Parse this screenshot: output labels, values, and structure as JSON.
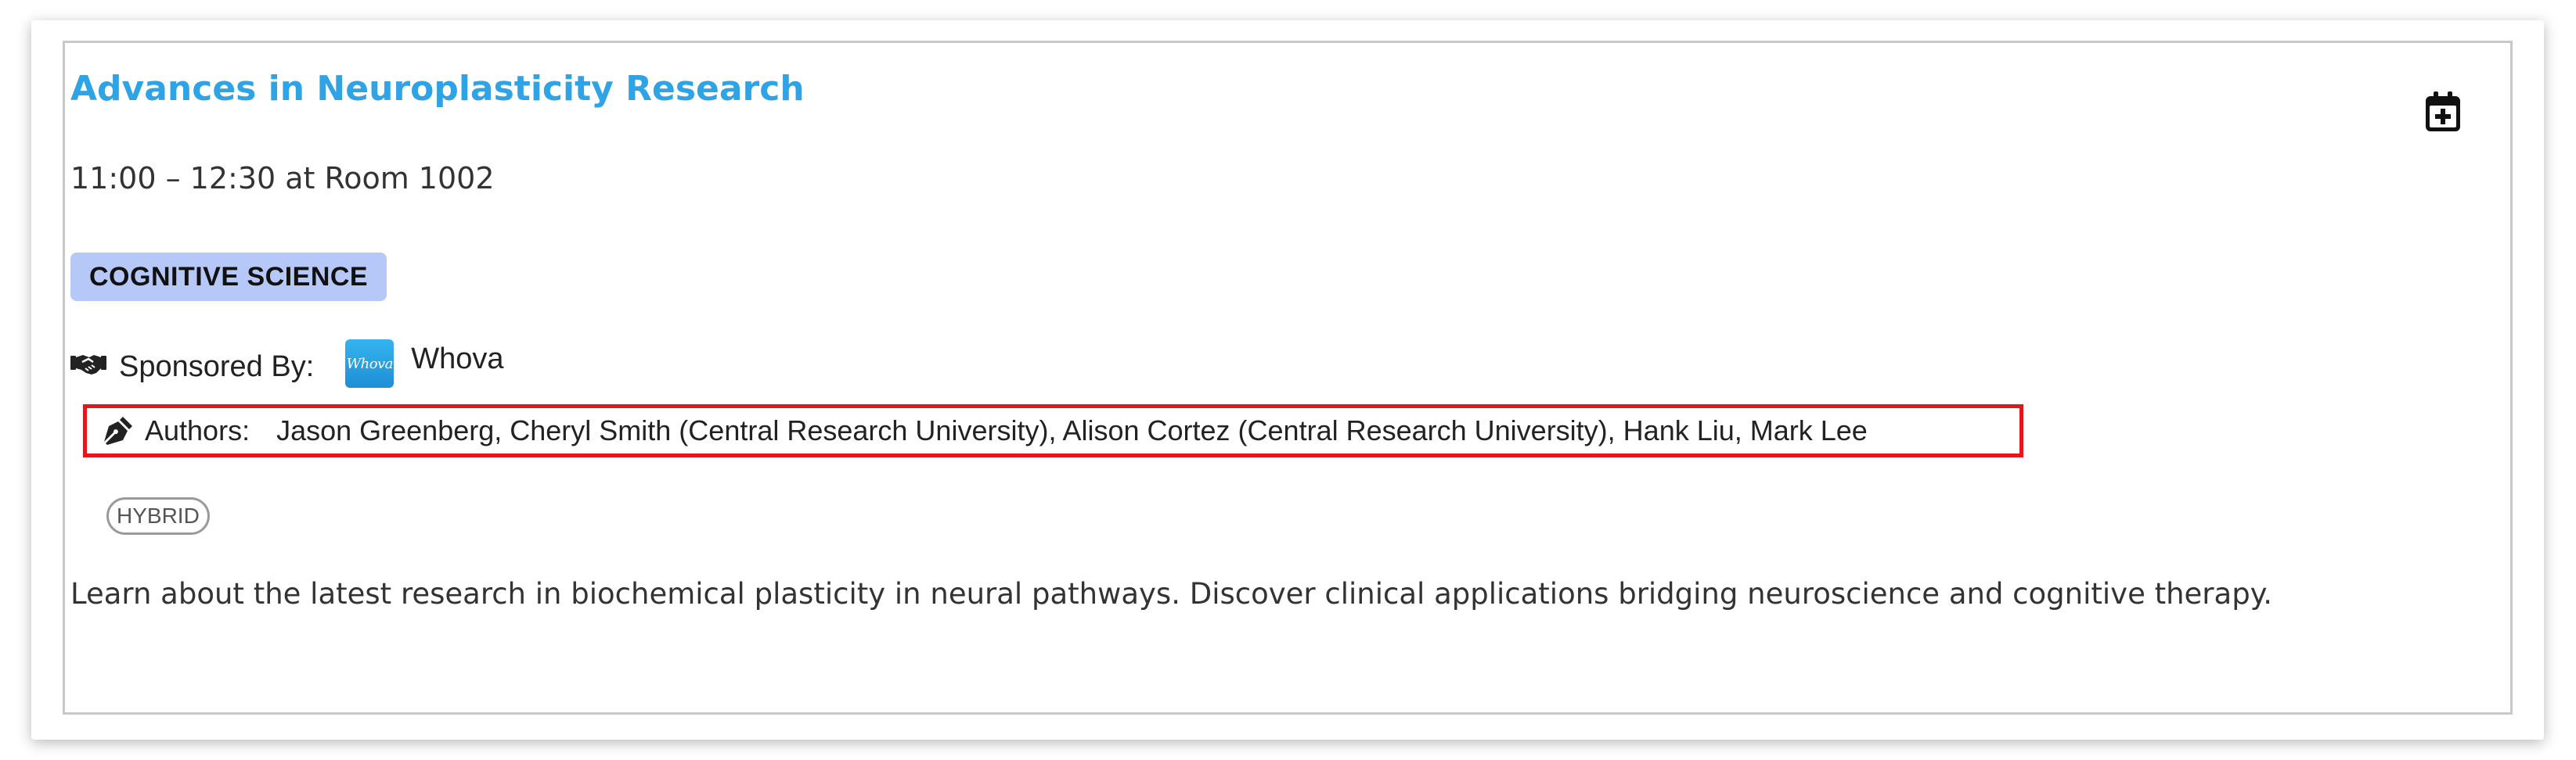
{
  "session": {
    "title": "Advances in Neuroplasticity Research",
    "time_location": "11:00 – 12:30 at Room 1002",
    "track": "COGNITIVE SCIENCE",
    "sponsor_label": "Sponsored By:",
    "sponsor_logo_text": "Whova",
    "sponsor_name": "Whova",
    "authors_label": "Authors:",
    "authors": "Jason Greenberg, Cheryl Smith (Central Research University), Alison Cortez (Central Research University), Hank Liu, Mark Lee",
    "format": "HYBRID",
    "description": "Learn about the latest research in biochemical plasticity in neural pathways. Discover clinical applications bridging neuroscience and cognitive therapy."
  },
  "icons": {
    "add_to_calendar": "calendar-plus-icon",
    "sponsor": "handshake-icon",
    "authors": "pen-nib-icon"
  },
  "colors": {
    "title": "#2ea3e6",
    "track_tag_bg": "#b6c8f7",
    "highlight_border": "#e0181e",
    "sponsor_logo": "#2aa6e8"
  }
}
